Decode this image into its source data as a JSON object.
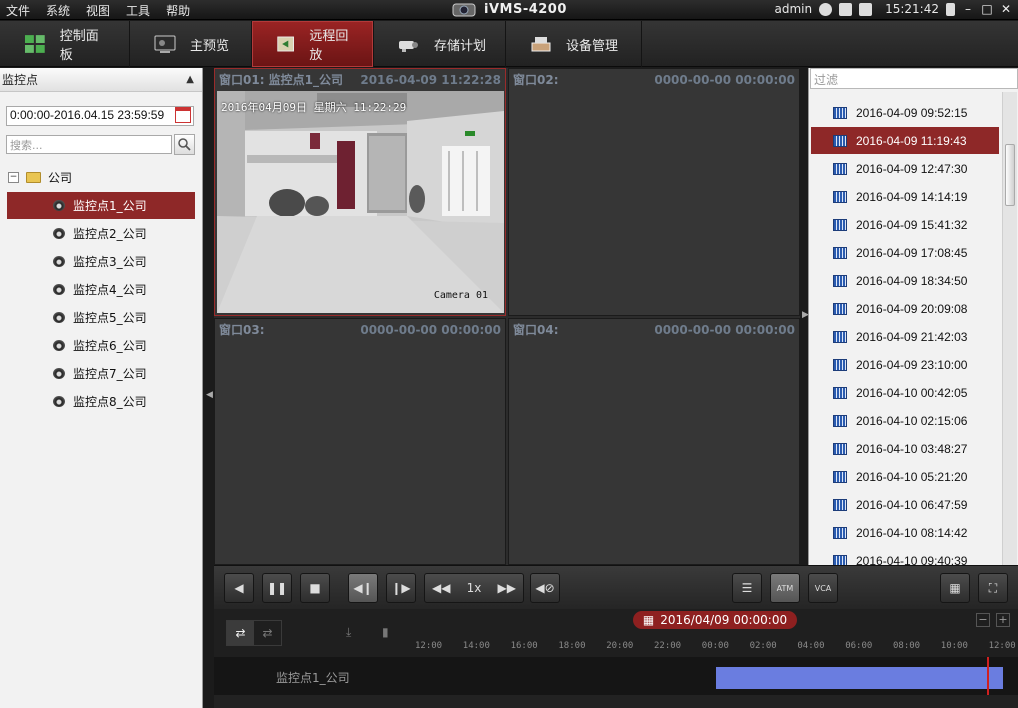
{
  "menu": [
    "文件",
    "系统",
    "视图",
    "工具",
    "帮助"
  ],
  "app_title": "iVMS-4200",
  "user": "admin",
  "clock": "15:21:42",
  "tabs": [
    {
      "label": "控制面板",
      "icon": "grid-icon"
    },
    {
      "label": "主预览",
      "icon": "monitor-icon"
    },
    {
      "label": "远程回放",
      "icon": "playback-icon"
    },
    {
      "label": "存储计划",
      "icon": "camera-storage-icon"
    },
    {
      "label": "设备管理",
      "icon": "device-icon"
    }
  ],
  "left_panel": {
    "title": "监控点",
    "time_range": "0:00:00-2016.04.15 23:59:59",
    "search_placeholder": "搜索...",
    "root": "公司",
    "cameras": [
      "监控点1_公司",
      "监控点2_公司",
      "监控点3_公司",
      "监控点4_公司",
      "监控点5_公司",
      "监控点6_公司",
      "监控点7_公司",
      "监控点8_公司"
    ],
    "selected_index": 0
  },
  "panes": [
    {
      "title": "窗口01: 监控点1_公司",
      "time": "2016-04-09 11:22:28"
    },
    {
      "title": "窗口02:",
      "time": "0000-00-00 00:00:00"
    },
    {
      "title": "窗口03:",
      "time": "0000-00-00 00:00:00"
    },
    {
      "title": "窗口04:",
      "time": "0000-00-00 00:00:00"
    }
  ],
  "feed": {
    "osd_time": "2016年04月09日 星期六 11:22:29",
    "osd_camera": "Camera 01"
  },
  "right_panel": {
    "filter_placeholder": "过滤",
    "records": [
      "2016-04-09 09:52:15",
      "2016-04-09 11:19:43",
      "2016-04-09 12:47:30",
      "2016-04-09 14:14:19",
      "2016-04-09 15:41:32",
      "2016-04-09 17:08:45",
      "2016-04-09 18:34:50",
      "2016-04-09 20:09:08",
      "2016-04-09 21:42:03",
      "2016-04-09 23:10:00",
      "2016-04-10 00:42:05",
      "2016-04-10 02:15:06",
      "2016-04-10 03:48:27",
      "2016-04-10 05:21:20",
      "2016-04-10 06:47:59",
      "2016-04-10 08:14:42",
      "2016-04-10 09:40:39"
    ],
    "selected_index": 1
  },
  "controls": {
    "speed": "1x"
  },
  "timeline": {
    "date": "2016/04/09 00:00:00",
    "ticks": [
      "12:00",
      "14:00",
      "16:00",
      "18:00",
      "20:00",
      "22:00",
      "00:00",
      "02:00",
      "04:00",
      "06:00",
      "08:00",
      "10:00",
      "12:00"
    ],
    "track_label": "监控点1_公司"
  },
  "colors": {
    "accent": "#8e2828",
    "timeline_bar": "#6a7de0"
  }
}
